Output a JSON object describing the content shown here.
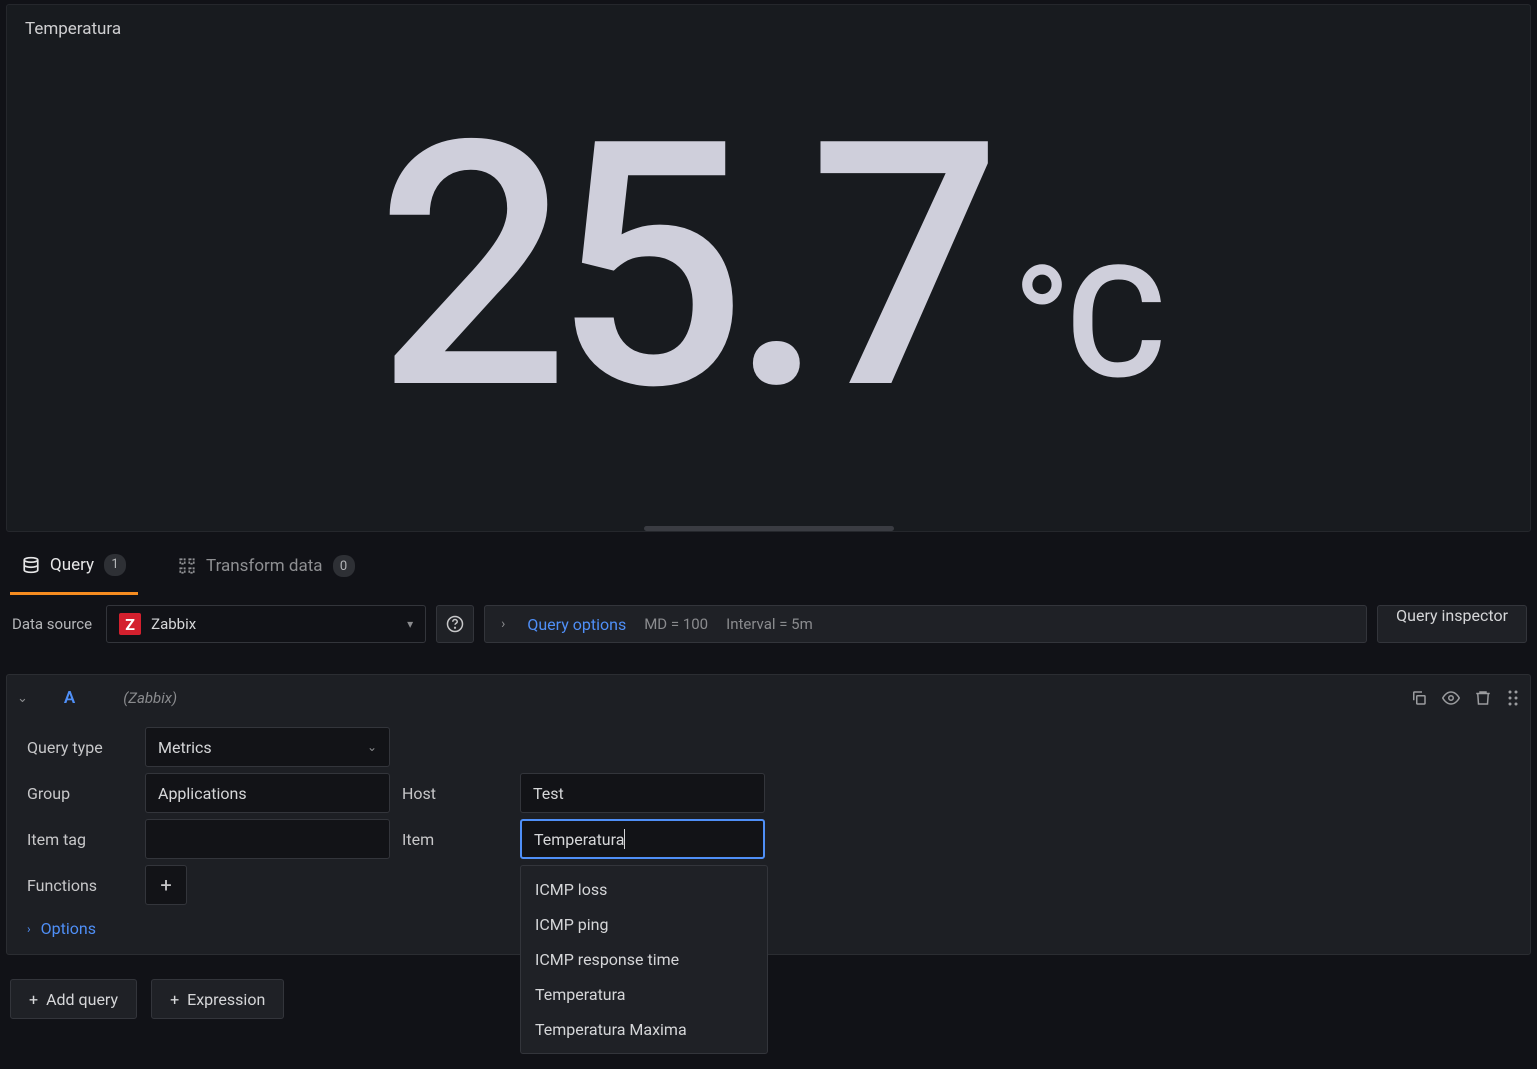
{
  "panel": {
    "title": "Temperatura",
    "value": "25.7",
    "unit": "°C"
  },
  "tabs": {
    "query": {
      "label": "Query",
      "count": "1"
    },
    "transform": {
      "label": "Transform data",
      "count": "0"
    }
  },
  "datasource": {
    "label": "Data source",
    "name": "Zabbix",
    "logo_letter": "Z"
  },
  "query_options": {
    "link": "Query options",
    "md": "MD = 100",
    "interval": "Interval = 5m"
  },
  "inspector": {
    "label": "Query inspector"
  },
  "query": {
    "ref": "A",
    "source": "(Zabbix)",
    "labels": {
      "query_type": "Query type",
      "group": "Group",
      "host": "Host",
      "item_tag": "Item tag",
      "item": "Item",
      "functions": "Functions",
      "options": "Options"
    },
    "values": {
      "query_type": "Metrics",
      "group": "Applications",
      "host": "Test",
      "item_tag": "",
      "item": "Temperatura"
    },
    "dropdown_items": [
      "ICMP loss",
      "ICMP ping",
      "ICMP response time",
      "Temperatura",
      "Temperatura Maxima"
    ]
  },
  "footer": {
    "add_query": "Add query",
    "expression": "Expression"
  }
}
